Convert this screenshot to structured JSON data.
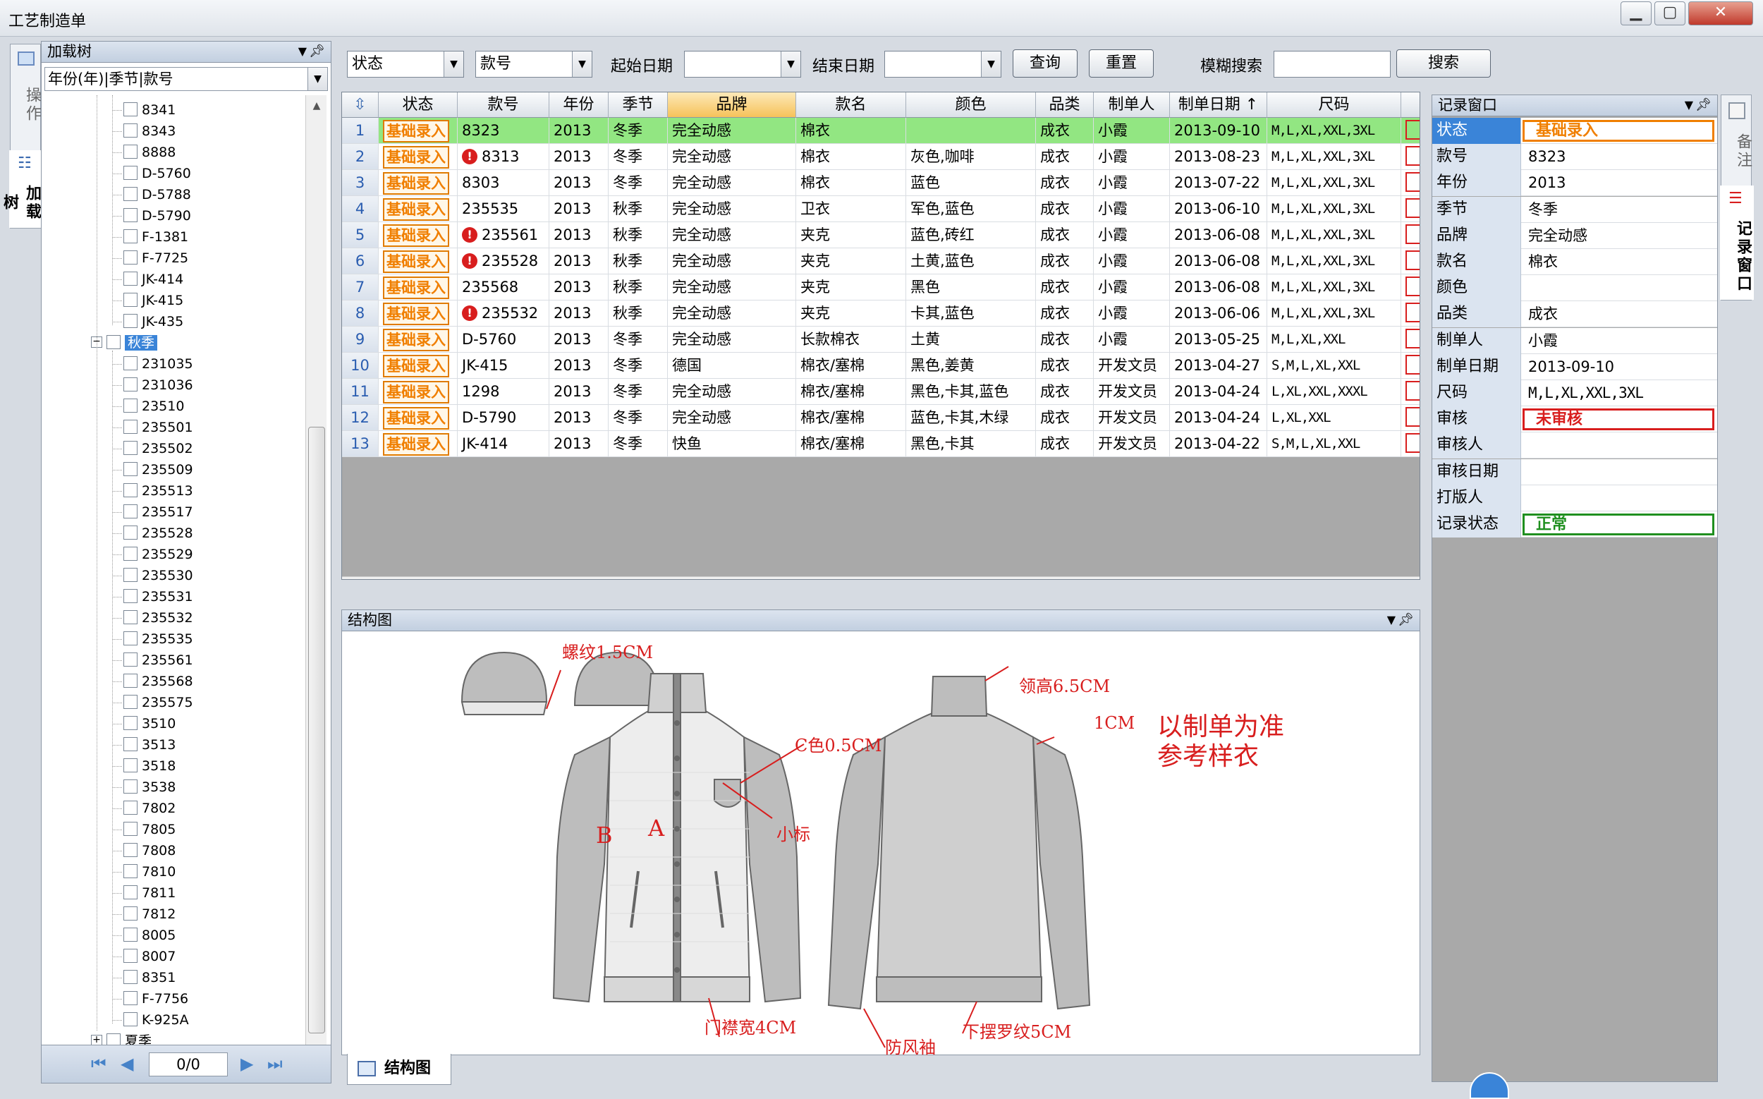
{
  "window": {
    "title": "工艺制造单"
  },
  "left_vtabs": [
    "操作",
    "加载树"
  ],
  "right_vtabs": [
    "备注",
    "记录窗口"
  ],
  "tree_panel": {
    "title": "加载树",
    "combo_value": "年份(年)|季节|款号",
    "winter_items": [
      "8341",
      "8343",
      "8888",
      "D-5760",
      "D-5788",
      "D-5790",
      "F-1381",
      "F-7725",
      "JK-414",
      "JK-415",
      "JK-435"
    ],
    "autumn_label": "秋季",
    "autumn_items": [
      "231035",
      "231036",
      "23510",
      "235501",
      "235502",
      "235509",
      "235513",
      "235517",
      "235528",
      "235529",
      "235530",
      "235531",
      "235532",
      "235535",
      "235561",
      "235568",
      "235575",
      "3510",
      "3513",
      "3518",
      "3538",
      "7802",
      "7805",
      "7808",
      "7810",
      "7811",
      "7812",
      "8005",
      "8007",
      "8351",
      "F-7756",
      "K-925A"
    ],
    "summer_label": "夏季",
    "page": "0/0"
  },
  "toolbar": {
    "status_combo": "状态",
    "style_combo": "款号",
    "start_date_label": "起始日期",
    "end_date_label": "结束日期",
    "query_button": "查询",
    "reset_button": "重置",
    "fuzzy_label": "模糊搜索",
    "search_button": "搜索"
  },
  "grid": {
    "columns": [
      "状态",
      "款号",
      "年份",
      "季节",
      "品牌",
      "款名",
      "颜色",
      "品类",
      "制单人",
      "制单日期 ↑",
      "尺码"
    ],
    "rows": [
      {
        "n": "1",
        "status": "基础录入",
        "warn": false,
        "code": "8323",
        "year": "2013",
        "season": "冬季",
        "brand": "完全动感",
        "name": "棉衣",
        "color": "",
        "cat": "成衣",
        "maker": "小霞",
        "date": "2013-09-10",
        "size": "M,L,XL,XXL,3XL"
      },
      {
        "n": "2",
        "status": "基础录入",
        "warn": true,
        "code": "8313",
        "year": "2013",
        "season": "冬季",
        "brand": "完全动感",
        "name": "棉衣",
        "color": "灰色,咖啡",
        "cat": "成衣",
        "maker": "小霞",
        "date": "2013-08-23",
        "size": "M,L,XL,XXL,3XL"
      },
      {
        "n": "3",
        "status": "基础录入",
        "warn": false,
        "code": "8303",
        "year": "2013",
        "season": "冬季",
        "brand": "完全动感",
        "name": "棉衣",
        "color": "蓝色",
        "cat": "成衣",
        "maker": "小霞",
        "date": "2013-07-22",
        "size": "M,L,XL,XXL,3XL"
      },
      {
        "n": "4",
        "status": "基础录入",
        "warn": false,
        "code": "235535",
        "year": "2013",
        "season": "秋季",
        "brand": "完全动感",
        "name": "卫衣",
        "color": "军色,蓝色",
        "cat": "成衣",
        "maker": "小霞",
        "date": "2013-06-10",
        "size": "M,L,XL,XXL,3XL"
      },
      {
        "n": "5",
        "status": "基础录入",
        "warn": true,
        "code": "235561",
        "year": "2013",
        "season": "秋季",
        "brand": "完全动感",
        "name": "夹克",
        "color": "蓝色,砖红",
        "cat": "成衣",
        "maker": "小霞",
        "date": "2013-06-08",
        "size": "M,L,XL,XXL,3XL"
      },
      {
        "n": "6",
        "status": "基础录入",
        "warn": true,
        "code": "235528",
        "year": "2013",
        "season": "秋季",
        "brand": "完全动感",
        "name": "夹克",
        "color": "土黄,蓝色",
        "cat": "成衣",
        "maker": "小霞",
        "date": "2013-06-08",
        "size": "M,L,XL,XXL,3XL"
      },
      {
        "n": "7",
        "status": "基础录入",
        "warn": false,
        "code": "235568",
        "year": "2013",
        "season": "秋季",
        "brand": "完全动感",
        "name": "夹克",
        "color": "黑色",
        "cat": "成衣",
        "maker": "小霞",
        "date": "2013-06-08",
        "size": "M,L,XL,XXL,3XL"
      },
      {
        "n": "8",
        "status": "基础录入",
        "warn": true,
        "code": "235532",
        "year": "2013",
        "season": "秋季",
        "brand": "完全动感",
        "name": "夹克",
        "color": "卡其,蓝色",
        "cat": "成衣",
        "maker": "小霞",
        "date": "2013-06-06",
        "size": "M,L,XL,XXL,3XL"
      },
      {
        "n": "9",
        "status": "基础录入",
        "warn": false,
        "code": "D-5760",
        "year": "2013",
        "season": "冬季",
        "brand": "完全动感",
        "name": "长款棉衣",
        "color": "土黄",
        "cat": "成衣",
        "maker": "小霞",
        "date": "2013-05-25",
        "size": "M,L,XL,XXL"
      },
      {
        "n": "10",
        "status": "基础录入",
        "warn": false,
        "code": "JK-415",
        "year": "2013",
        "season": "冬季",
        "brand": "德国",
        "name": "棉衣/塞棉",
        "color": "黑色,姜黄",
        "cat": "成衣",
        "maker": "开发文员",
        "date": "2013-04-27",
        "size": "S,M,L,XL,XXL"
      },
      {
        "n": "11",
        "status": "基础录入",
        "warn": false,
        "code": "1298",
        "year": "2013",
        "season": "冬季",
        "brand": "完全动感",
        "name": "棉衣/塞棉",
        "color": "黑色,卡其,蓝色",
        "cat": "成衣",
        "maker": "开发文员",
        "date": "2013-04-24",
        "size": "L,XL,XXL,XXXL"
      },
      {
        "n": "12",
        "status": "基础录入",
        "warn": false,
        "code": "D-5790",
        "year": "2013",
        "season": "冬季",
        "brand": "完全动感",
        "name": "棉衣/塞棉",
        "color": "蓝色,卡其,木绿",
        "cat": "成衣",
        "maker": "开发文员",
        "date": "2013-04-24",
        "size": "L,XL,XXL"
      },
      {
        "n": "13",
        "status": "基础录入",
        "warn": false,
        "code": "JK-414",
        "year": "2013",
        "season": "冬季",
        "brand": "快鱼",
        "name": "棉衣/塞棉",
        "color": "黑色,卡其",
        "cat": "成衣",
        "maker": "开发文员",
        "date": "2013-04-22",
        "size": "S,M,L,XL,XXL"
      }
    ]
  },
  "structure": {
    "title": "结构图",
    "tab": "结构图",
    "notes": {
      "rib": "螺纹1.5CM",
      "collar": "领高6.5CM",
      "edge": "1CM",
      "color_strip": "C色0.5CM",
      "label": "小标",
      "placket": "门襟宽4CM",
      "cuff": "防风袖",
      "hem": "下摆罗纹5CM",
      "part_a": "A",
      "part_b": "B",
      "ref1": "以制单为准",
      "ref2": "参考样衣"
    }
  },
  "record": {
    "title": "记录窗口",
    "fields": [
      {
        "label": "状态",
        "value": "基础录入",
        "kind": "orange"
      },
      {
        "label": "款号",
        "value": "8323"
      },
      {
        "label": "年份",
        "value": "2013"
      },
      {
        "label": "季节",
        "value": "冬季"
      },
      {
        "label": "品牌",
        "value": "完全动感"
      },
      {
        "label": "款名",
        "value": "棉衣"
      },
      {
        "label": "颜色",
        "value": ""
      },
      {
        "label": "品类",
        "value": "成衣"
      },
      {
        "label": "制单人",
        "value": "小霞"
      },
      {
        "label": "制单日期",
        "value": "2013-09-10"
      },
      {
        "label": "尺码",
        "value": "M,L,XL,XXL,3XL"
      },
      {
        "label": "审核",
        "value": "未审核",
        "kind": "red"
      },
      {
        "label": "审核人",
        "value": ""
      },
      {
        "label": "审核日期",
        "value": ""
      },
      {
        "label": "打版人",
        "value": ""
      },
      {
        "label": "记录状态",
        "value": "正常",
        "kind": "green"
      }
    ]
  },
  "colors": {
    "orange": "#f07f00",
    "red": "#d81e1e",
    "green": "#1f8f1f",
    "selected_row": "#92e682",
    "header_hl": "#f6c25a",
    "accent": "#3a84d8"
  }
}
